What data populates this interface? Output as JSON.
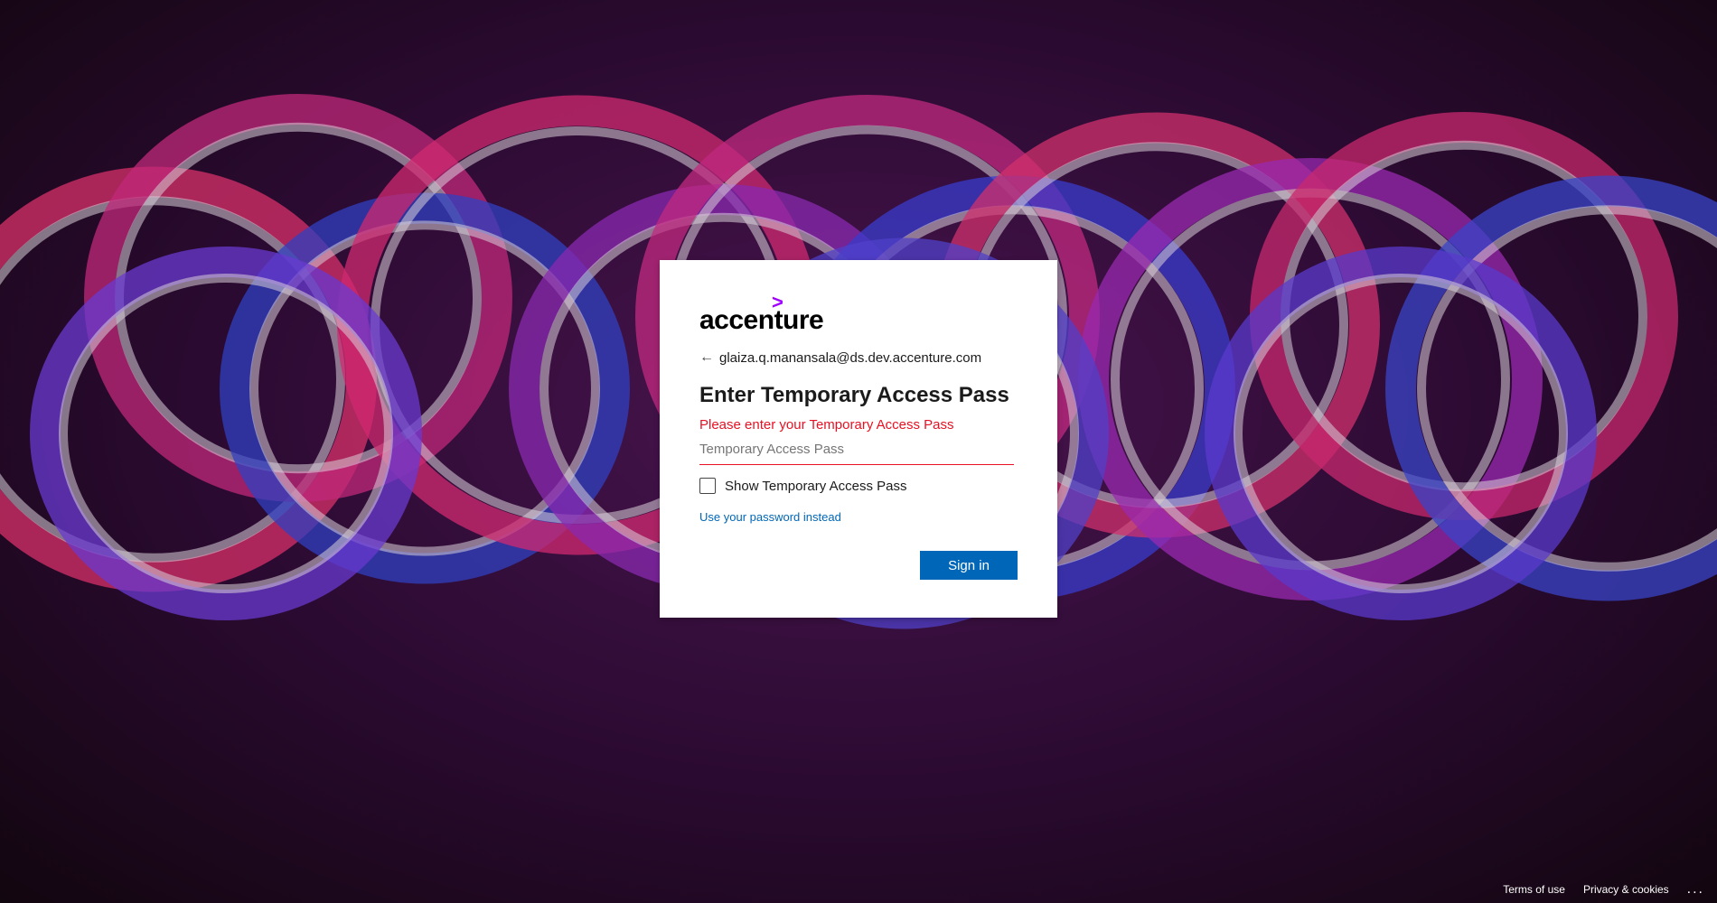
{
  "logo": {
    "text": "accenture",
    "chevron": ">"
  },
  "identity": {
    "back_icon": "←",
    "email": "glaiza.q.manansala@ds.dev.accenture.com"
  },
  "title": "Enter Temporary Access Pass",
  "error": "Please enter your Temporary Access Pass",
  "input": {
    "placeholder": "Temporary Access Pass",
    "value": ""
  },
  "show_checkbox": {
    "label": "Show Temporary Access Pass",
    "checked": false
  },
  "alt_link": "Use your password instead",
  "signin_button": "Sign in",
  "footer": {
    "terms": "Terms of use",
    "privacy": "Privacy & cookies",
    "more": "..."
  },
  "colors": {
    "brand_purple": "#a100ff",
    "primary_blue": "#0067b8",
    "error_red": "#e81123"
  }
}
